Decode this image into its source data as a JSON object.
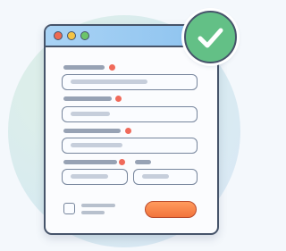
{
  "window": {
    "traffic_lights": [
      "red",
      "yellow",
      "green"
    ],
    "colors": {
      "titlebar": "#8cc2ef",
      "frame": "#46546a",
      "required": "#f06a5a",
      "submit": "#f2743c"
    }
  },
  "form": {
    "fields": [
      {
        "required": true
      },
      {
        "required": true
      },
      {
        "required": true
      },
      {
        "required": true
      },
      {
        "required": false
      }
    ],
    "checkbox": {
      "checked": false
    },
    "submit_button": {
      "color": "#f2743c"
    }
  },
  "badge": {
    "icon": "checkmark-icon",
    "color": "#63c086"
  }
}
